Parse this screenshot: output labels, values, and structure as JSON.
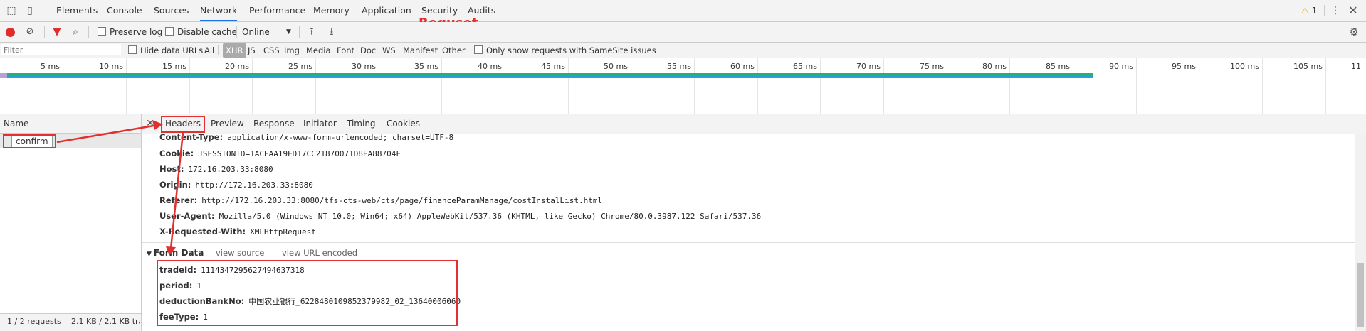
{
  "devtools_tabs": [
    "Elements",
    "Console",
    "Sources",
    "Network",
    "Performance",
    "Memory",
    "Application",
    "Security",
    "Audits"
  ],
  "active_tab": "Network",
  "warning_count": "1",
  "annotation_label": "Requset",
  "toolbar": {
    "preserve_log": "Preserve log",
    "disable_cache": "Disable cache",
    "throttling": "Online"
  },
  "filter": {
    "placeholder": "Filter",
    "hide_data_urls": "Hide data URLs",
    "types": [
      "All",
      "XHR",
      "JS",
      "CSS",
      "Img",
      "Media",
      "Font",
      "Doc",
      "WS",
      "Manifest",
      "Other"
    ],
    "selected_type": "XHR",
    "samesite": "Only show requests with SameSite issues"
  },
  "timeline": {
    "ticks": [
      "5 ms",
      "10 ms",
      "15 ms",
      "20 ms",
      "25 ms",
      "30 ms",
      "35 ms",
      "40 ms",
      "45 ms",
      "50 ms",
      "55 ms",
      "60 ms",
      "65 ms",
      "70 ms",
      "75 ms",
      "80 ms",
      "85 ms",
      "90 ms",
      "95 ms",
      "100 ms",
      "105 ms",
      "11"
    ],
    "bar_color": "#2a9fd6",
    "bar_top_color": "#22b07d"
  },
  "requests": {
    "column_name": "Name",
    "items": [
      {
        "name": "confirm"
      }
    ],
    "summary": "1 / 2 requests",
    "transfer": "2.1 KB / 2.1 KB tra"
  },
  "details": {
    "tabs": [
      "Headers",
      "Preview",
      "Response",
      "Initiator",
      "Timing",
      "Cookies"
    ],
    "active_tab": "Headers",
    "request_headers": [
      {
        "key": "Content-Type:",
        "value": "application/x-www-form-urlencoded; charset=UTF-8"
      },
      {
        "key": "Cookie:",
        "value": "JSESSIONID=1ACEAA19ED17CC21870071D8EA88704F"
      },
      {
        "key": "Host:",
        "value": "172.16.203.33:8080"
      },
      {
        "key": "Origin:",
        "value": "http://172.16.203.33:8080"
      },
      {
        "key": "Referer:",
        "value": "http://172.16.203.33:8080/tfs-cts-web/cts/page/financeParamManage/costInstalList.html"
      },
      {
        "key": "User-Agent:",
        "value": "Mozilla/5.0 (Windows NT 10.0; Win64; x64) AppleWebKit/537.36 (KHTML, like Gecko) Chrome/80.0.3987.122 Safari/537.36"
      },
      {
        "key": "X-Requested-With:",
        "value": "XMLHttpRequest"
      }
    ],
    "form_data_title": "Form Data",
    "view_source": "view source",
    "view_url_encoded": "view URL encoded",
    "form_data": [
      {
        "key": "tradeId:",
        "value": "1114347295627494637318"
      },
      {
        "key": "period:",
        "value": "1"
      },
      {
        "key": "deductionBankNo:",
        "value": "中国农业银行_6228480109852379982_02_13640006060"
      },
      {
        "key": "feeType:",
        "value": "1"
      }
    ]
  },
  "colors": {
    "annotation": "#e03030",
    "accent": "#1a73e8",
    "record": "#e02c2c"
  }
}
